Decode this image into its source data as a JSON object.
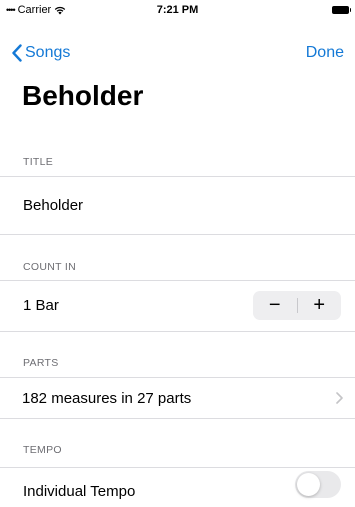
{
  "status_bar": {
    "carrier": "Carrier",
    "time": "7:21 PM"
  },
  "nav": {
    "back_label": "Songs",
    "done_label": "Done"
  },
  "page_title": "Beholder",
  "sections": {
    "title": {
      "header": "TITLE",
      "value": "Beholder"
    },
    "count_in": {
      "header": "COUNT IN",
      "value": "1 Bar",
      "decrement_symbol": "−",
      "increment_symbol": "+"
    },
    "parts": {
      "header": "PARTS",
      "value": "182 measures in 27 parts"
    },
    "tempo": {
      "header": "TEMPO",
      "value": "Individual Tempo",
      "toggle_on": false
    }
  },
  "colors": {
    "accent": "#1479d6",
    "section_header": "#6d6d72",
    "separator": "#dcdce0",
    "toggle_off": "#e9e9eb"
  }
}
